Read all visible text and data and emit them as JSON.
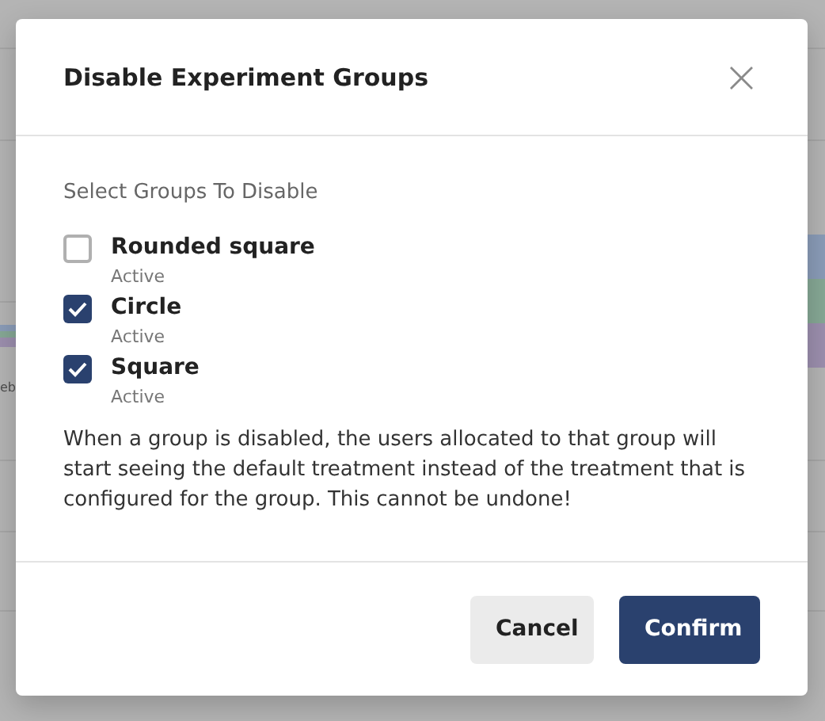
{
  "background": {
    "axis_label": "eb"
  },
  "dialog": {
    "title": "Disable Experiment Groups",
    "close_label": "×",
    "section_label": "Select Groups To Disable",
    "groups": [
      {
        "name": "Rounded square",
        "status": "Active",
        "checked": false
      },
      {
        "name": "Circle",
        "status": "Active",
        "checked": true
      },
      {
        "name": "Square",
        "status": "Active",
        "checked": true
      }
    ],
    "warning": "When a group is disabled, the users allocated to that group will start seeing the default treatment instead of the treatment that is configured for the group. This cannot be undone!",
    "buttons": [
      {
        "label": "Cancel",
        "kind": "secondary"
      },
      {
        "label": "Confirm",
        "kind": "primary"
      }
    ]
  }
}
